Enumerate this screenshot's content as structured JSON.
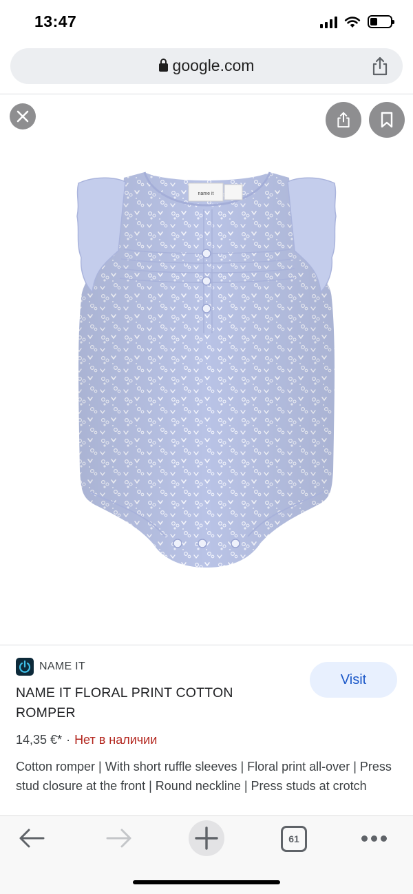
{
  "status_bar": {
    "time": "13:47",
    "battery_level": 0.35,
    "icons": [
      "cellular-signal-icon",
      "wifi-icon",
      "battery-icon"
    ]
  },
  "browser": {
    "url": "google.com",
    "icons": [
      "lock-icon",
      "share-icon"
    ]
  },
  "viewer": {
    "icons": [
      "close-icon",
      "share-icon",
      "bookmark-icon"
    ],
    "garment_tag": "name it"
  },
  "result": {
    "brand": "NAME IT",
    "visit_label": "Visit",
    "title": "NAME IT FLORAL PRINT COTTON ROMPER",
    "price": "14,35 €*",
    "separator": "·",
    "availability": "Нет в наличии",
    "description": "Cotton romper | With short ruffle sleeves | Floral print all-over | Press stud closure at the front | Round neckline | Press studs at crotch"
  },
  "toolbar": {
    "tab_count": "61",
    "icons": [
      "back-arrow-icon",
      "forward-arrow-icon",
      "new-tab-plus-icon",
      "tab-switcher-icon",
      "more-dots-icon"
    ]
  },
  "colors": {
    "accent": "#1a57c8",
    "visit_bg": "#e8f0fe",
    "out_of_stock": "#b3261e",
    "romper": "#b8c3e6"
  }
}
